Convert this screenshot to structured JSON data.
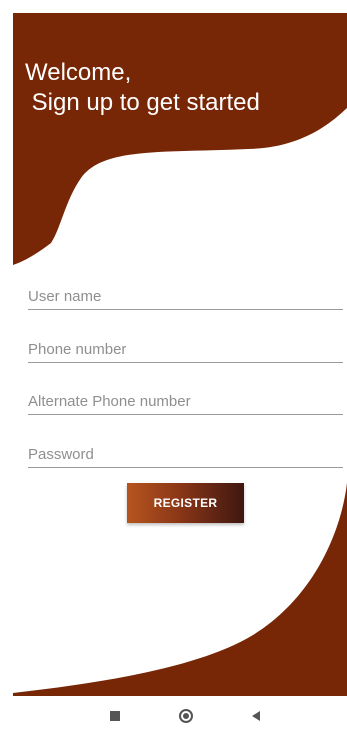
{
  "header": {
    "title": "Welcome,\n Sign up to get started"
  },
  "form": {
    "username_placeholder": "User name",
    "phone_placeholder": "Phone number",
    "alt_phone_placeholder": "Alternate Phone number",
    "password_placeholder": "Password",
    "register_label": "REGISTER"
  },
  "colors": {
    "brand": "#772606",
    "background": "#ffffff",
    "button_gradient_start": "#b6551f",
    "button_gradient_end": "#3f1710"
  },
  "nav_bar": {
    "icons": [
      "recents-square-icon",
      "home-circle-icon",
      "back-triangle-icon"
    ]
  }
}
